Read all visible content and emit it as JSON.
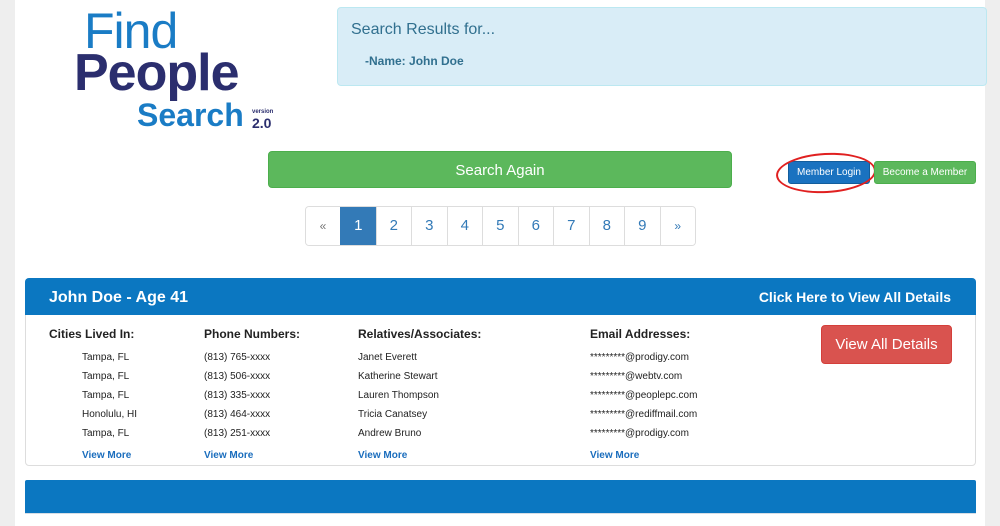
{
  "logo": {
    "line1": "Find",
    "line2": "People",
    "line3": "Search",
    "version_label": "version",
    "version_number": "2.0"
  },
  "search_summary": {
    "title": "Search Results for...",
    "criteria_prefix": "-Name: ",
    "criteria_value": "John Doe"
  },
  "actions": {
    "search_again": "Search Again",
    "member_login": "Member Login",
    "become_member": "Become a Member"
  },
  "pagination": {
    "prev": "«",
    "next": "»",
    "pages": [
      "1",
      "2",
      "3",
      "4",
      "5",
      "6",
      "7",
      "8",
      "9"
    ],
    "current": "1"
  },
  "result": {
    "name_age": "John Doe -  Age 41",
    "view_all_link": "Click Here to View All Details",
    "view_all_button": "View All Details",
    "columns": {
      "cities": {
        "header": "Cities Lived In:",
        "items": [
          "Tampa, FL",
          "Tampa, FL",
          "Tampa, FL",
          "Honolulu, HI",
          "Tampa, FL"
        ],
        "more": "View More"
      },
      "phones": {
        "header": "Phone Numbers:",
        "items": [
          "(813) 765-xxxx",
          "(813) 506-xxxx",
          "(813) 335-xxxx",
          "(813) 464-xxxx",
          "(813) 251-xxxx"
        ],
        "more": "View More"
      },
      "relatives": {
        "header": "Relatives/Associates:",
        "items": [
          "Janet Everett",
          "Katherine Stewart",
          "Lauren Thompson",
          "Tricia Canatsey",
          "Andrew Bruno"
        ],
        "more": "View More"
      },
      "emails": {
        "header": "Email Addresses:",
        "items": [
          "*********@prodigy.com",
          "*********@webtv.com",
          "*********@peoplepc.com",
          "*********@rediffmail.com",
          "*********@prodigy.com"
        ],
        "more": "View More"
      }
    }
  },
  "colors": {
    "brand_blue": "#1a7cc5",
    "brand_navy": "#2b2e6e",
    "card_header": "#0b77c1",
    "success": "#5cb85c",
    "danger": "#d9534f",
    "highlight_circle": "#e02020"
  }
}
